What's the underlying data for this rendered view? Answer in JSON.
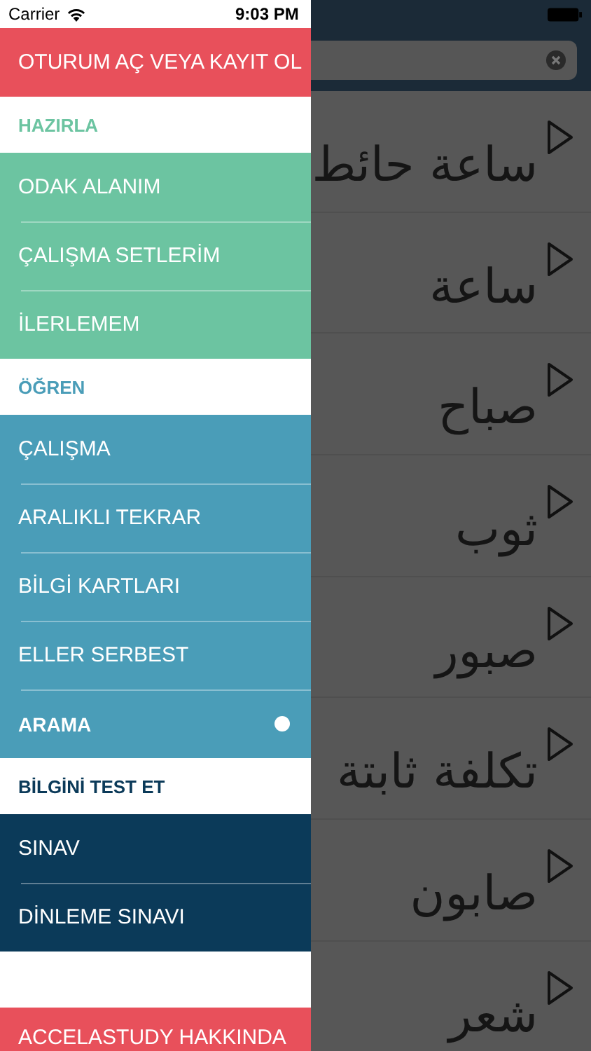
{
  "status_bar": {
    "carrier": "Carrier",
    "time": "9:03 PM"
  },
  "drawer": {
    "header": "OTURUM AÇ VEYA KAYIT OL",
    "sections": [
      {
        "title": "HAZIRLA",
        "color": "#6cc4a1",
        "items": [
          {
            "label": "ODAK ALANIM",
            "selected": false
          },
          {
            "label": "ÇALIŞMA SETLERİM",
            "selected": false
          },
          {
            "label": "İLERLEMEM",
            "selected": false
          }
        ]
      },
      {
        "title": "ÖĞREN",
        "color": "#4a9db8",
        "items": [
          {
            "label": "ÇALIŞMA",
            "selected": false
          },
          {
            "label": "ARALIKLI TEKRAR",
            "selected": false
          },
          {
            "label": "BİLGİ KARTLARI",
            "selected": false
          },
          {
            "label": "ELLER SERBEST",
            "selected": false
          },
          {
            "label": "ARAMA",
            "selected": true
          }
        ]
      },
      {
        "title": "BİLGİNİ TEST ET",
        "color": "#0b3a59",
        "items": [
          {
            "label": "SINAV",
            "selected": false
          },
          {
            "label": "DİNLEME SINAVI",
            "selected": false
          }
        ]
      }
    ],
    "footer": "ACCELASTUDY HAKKINDA"
  },
  "words": [
    "ساعة حائط",
    "ساعة",
    "صباح",
    "ثوب",
    "صبور",
    "تكلفة ثابتة",
    "صابون",
    "شعر"
  ]
}
